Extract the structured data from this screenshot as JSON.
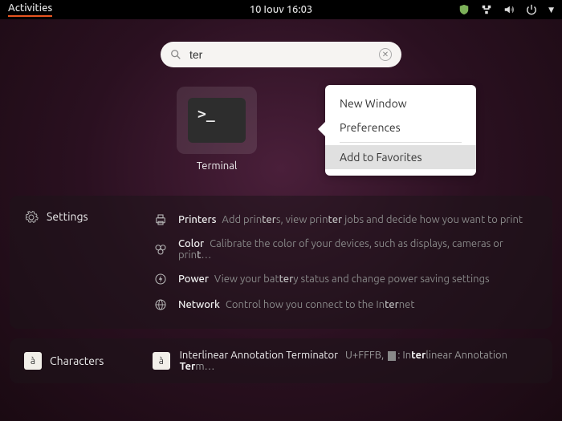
{
  "topbar": {
    "activities": "Activities",
    "clock": "10 Ιουν  16:03"
  },
  "search": {
    "value": "ter"
  },
  "app": {
    "label": "Terminal",
    "prompt": ">_"
  },
  "contextmenu": {
    "items": [
      {
        "label": "New Window",
        "sep": false,
        "hov": false
      },
      {
        "label": "Preferences",
        "sep": true,
        "hov": false
      },
      {
        "label": "Add to Favorites",
        "sep": false,
        "hov": true
      }
    ]
  },
  "settings": {
    "title": "Settings",
    "rows": [
      {
        "icon": "printer",
        "title": "Printers",
        "desc_before": " Add prin",
        "desc_bold1": "ter",
        "desc_mid": "s, view prin",
        "desc_bold2": "ter",
        "desc_after": " jobs and decide how you want to print"
      },
      {
        "icon": "color",
        "title": "Color",
        "desc_before": " Calibrate the color of your devices, such as displays, cameras or prin",
        "desc_bold1": "t",
        "desc_mid": "",
        "desc_bold2": "",
        "desc_after": "…"
      },
      {
        "icon": "power",
        "title": "Power",
        "desc_before": " View your bat",
        "desc_bold1": "ter",
        "desc_mid": "y status and change power saving settings",
        "desc_bold2": "",
        "desc_after": ""
      },
      {
        "icon": "network",
        "title": "Network",
        "desc_before": " Control how you connect to the In",
        "desc_bold1": "ter",
        "desc_mid": "net",
        "desc_bold2": "",
        "desc_after": ""
      }
    ]
  },
  "characters": {
    "title": "Characters",
    "glyph": "à",
    "entry": {
      "pre": "In",
      "b1": "ter",
      "mid1": "linear Annotation ",
      "b2": "Ter",
      "mid2": "minator",
      "code": "U+FFFB,",
      "post1": ": In",
      "b3": "ter",
      "post2": "linear Annotation ",
      "b4": "Ter",
      "post3": "m…"
    }
  }
}
